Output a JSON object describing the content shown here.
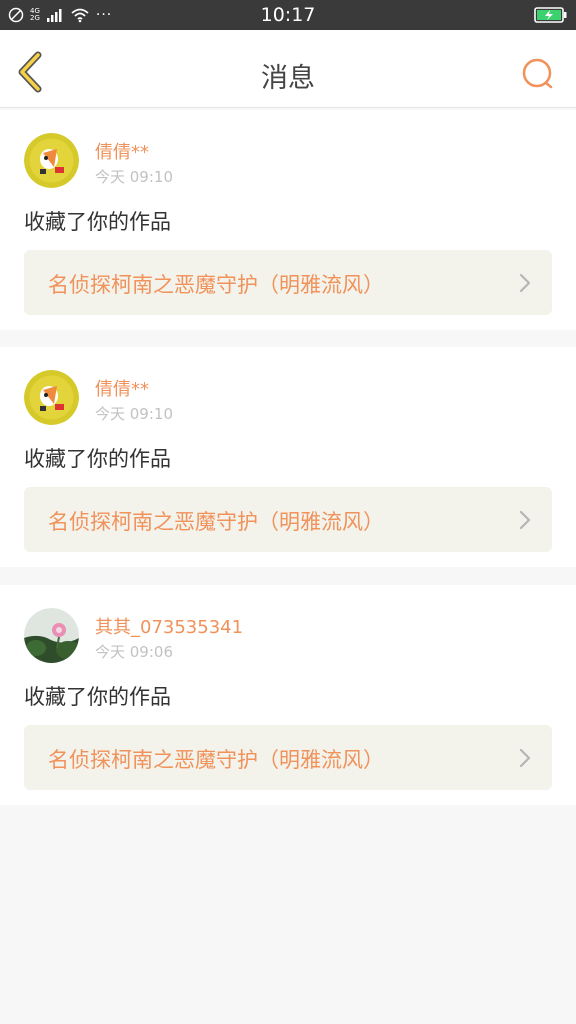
{
  "status_bar": {
    "time": "10:17",
    "network_top": "4G",
    "network_bottom": "2G",
    "more": "···",
    "icons": [
      "no-disturb-icon",
      "signal-icon",
      "wifi-icon",
      "battery-charging-icon"
    ]
  },
  "nav": {
    "title": "消息",
    "back_icon": "chevron-left-icon",
    "search_icon": "search-icon",
    "accent_color": "#f0925a"
  },
  "messages": [
    {
      "username": "倩倩**",
      "time": "今天 09:10",
      "action": "收藏了你的作品",
      "work_title": "名侦探柯南之恶魔守护（明雅流风）",
      "avatar": "cartoon-avatar"
    },
    {
      "username": "倩倩**",
      "time": "今天 09:10",
      "action": "收藏了你的作品",
      "work_title": "名侦探柯南之恶魔守护（明雅流风）",
      "avatar": "cartoon-avatar"
    },
    {
      "username": "其其_073535341",
      "time": "今天 09:06",
      "action": "收藏了你的作品",
      "work_title": "名侦探柯南之恶魔守护（明雅流风）",
      "avatar": "flower-photo-avatar"
    }
  ]
}
